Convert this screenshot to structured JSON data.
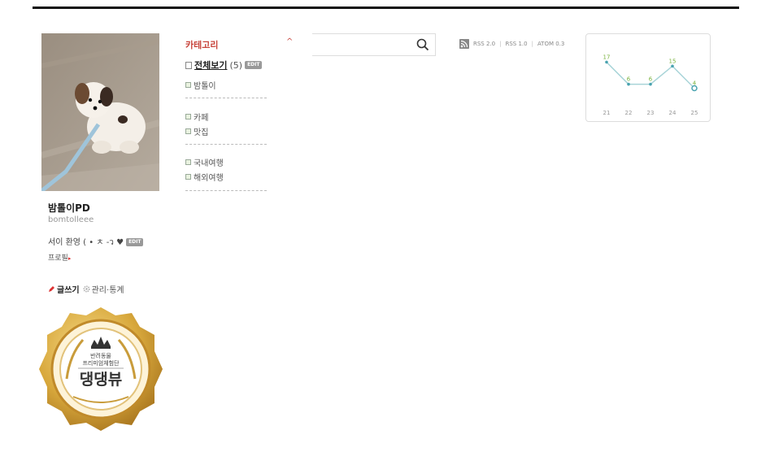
{
  "profile": {
    "name": "밤톨이PD",
    "id": "bomtolleee",
    "description": "서이 환영 ( • ㅊ -ว ♥",
    "edit_label": "EDIT",
    "profile_link": "프로필",
    "write_label": "글쓰기",
    "manage_label": "관리·통계",
    "badge": {
      "line1": "반려동물",
      "line2": "프리미엄체험단",
      "title": "댕댕뷰"
    }
  },
  "category": {
    "title": "카테고리",
    "toggle": "^",
    "all_label": "전체보기",
    "all_count": "(5)",
    "edit_label": "EDIT",
    "groups": [
      [
        "밤톨이"
      ],
      [
        "카페",
        "맛집"
      ],
      [
        "국내여행",
        "해외여행"
      ]
    ]
  },
  "rss": {
    "links": [
      "RSS 2.0",
      "RSS 1.0",
      "ATOM 0.3"
    ]
  },
  "colors": {
    "accent": "#c8453c",
    "chart_line": "#a8d4d8",
    "chart_dot": "#4aa3b0",
    "chart_label": "#7ab33f"
  },
  "chart_data": {
    "type": "line",
    "categories": [
      "21",
      "22",
      "23",
      "24",
      "25"
    ],
    "values": [
      17,
      6,
      6,
      15,
      4
    ],
    "ylim": [
      0,
      20
    ],
    "grid": false,
    "title": "",
    "xlabel": "",
    "ylabel": ""
  }
}
